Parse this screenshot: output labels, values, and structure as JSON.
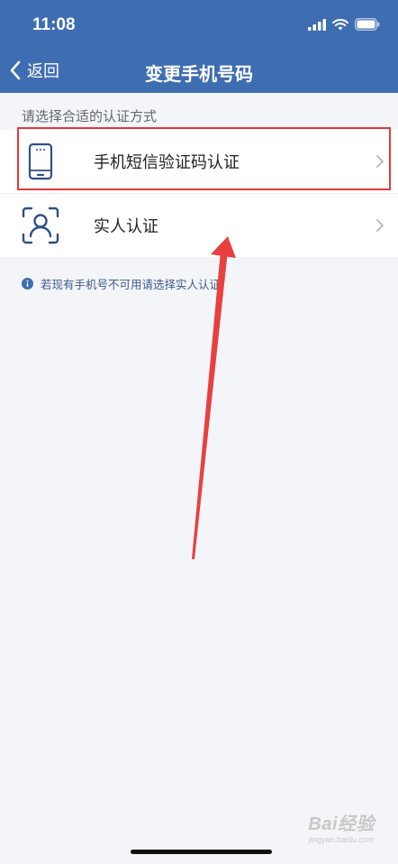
{
  "status_bar": {
    "time": "11:08",
    "icons": [
      "signal-icon",
      "wifi-icon",
      "battery-icon"
    ]
  },
  "nav": {
    "back_label": "返回",
    "title": "变更手机号码"
  },
  "section_label": "请选择合适的认证方式",
  "options": [
    {
      "label": "手机短信验证码认证",
      "icon": "phone-icon"
    },
    {
      "label": "实人认证",
      "icon": "face-scan-icon"
    }
  ],
  "notice": "若现有手机号不可用请选择实人认证",
  "watermark": {
    "brand": "Bai经验",
    "url": "jingyan.baidu.com"
  },
  "colors": {
    "header": "#3f6db2",
    "background": "#f3f5f9",
    "highlight": "#e23a3a",
    "icon": "#2f4f86"
  }
}
